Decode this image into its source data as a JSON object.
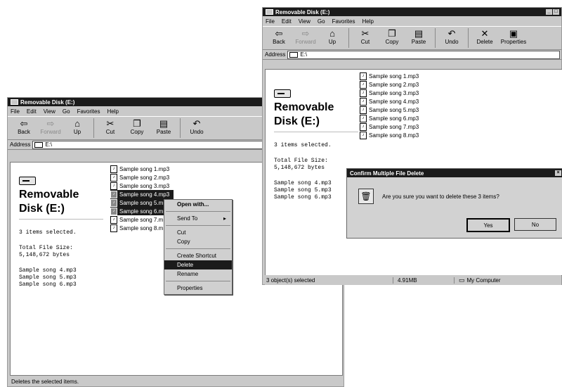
{
  "back_window": {
    "title": "Removable Disk (E:)",
    "menu": [
      "File",
      "Edit",
      "View",
      "Go",
      "Favorites",
      "Help"
    ],
    "toolbar": [
      {
        "icon": "back-icon",
        "label": "Back"
      },
      {
        "icon": "forward-icon",
        "label": "Forward"
      },
      {
        "icon": "up-icon",
        "label": "Up"
      },
      {
        "icon": "cut-icon",
        "label": "Cut"
      },
      {
        "icon": "copy-icon",
        "label": "Copy"
      },
      {
        "icon": "paste-icon",
        "label": "Paste"
      },
      {
        "icon": "undo-icon",
        "label": "Undo"
      }
    ],
    "address_label": "Address",
    "address_value": "E:\\",
    "panel": {
      "title_line1": "Removable",
      "title_line2": "Disk (E:)",
      "selected": "3 items selected.",
      "size_label": "Total File Size:",
      "size_value": "5,148,672 bytes",
      "selected_files": [
        "Sample song 4.mp3",
        "Sample song 5.mp3",
        "Sample song 6.mp3"
      ]
    },
    "files": [
      "Sample song 1.mp3",
      "Sample song 2.mp3",
      "Sample song 3.mp3",
      "Sample song 4.mp3",
      "Sample song 5.m",
      "Sample song 6.m",
      "Sample song 7.m",
      "Sample song 8.m"
    ],
    "status": "Deletes the selected items."
  },
  "context_menu": {
    "items": [
      "Open with...",
      "Send To",
      "Cut",
      "Copy",
      "Create Shortcut",
      "Delete",
      "Rename",
      "Properties"
    ]
  },
  "front_window": {
    "title": "Removable Disk (E:)",
    "menu": [
      "File",
      "Edit",
      "View",
      "Go",
      "Favorites",
      "Help"
    ],
    "toolbar": [
      {
        "icon": "back-icon",
        "label": "Back"
      },
      {
        "icon": "forward-icon",
        "label": "Forward"
      },
      {
        "icon": "up-icon",
        "label": "Up"
      },
      {
        "icon": "cut-icon",
        "label": "Cut"
      },
      {
        "icon": "copy-icon",
        "label": "Copy"
      },
      {
        "icon": "paste-icon",
        "label": "Paste"
      },
      {
        "icon": "undo-icon",
        "label": "Undo"
      },
      {
        "icon": "delete-icon",
        "label": "Delete"
      },
      {
        "icon": "properties-icon",
        "label": "Properties"
      }
    ],
    "address_label": "Address",
    "address_value": "E:\\",
    "panel": {
      "title_line1": "Removable",
      "title_line2": "Disk (E:)",
      "selected": "3 items selected.",
      "size_label": "Total File Size:",
      "size_value": "5,148,672 bytes",
      "selected_files": [
        "Sample song 4.mp3",
        "Sample song 5.mp3",
        "Sample song 6.mp3"
      ]
    },
    "files": [
      "Sample song 1.mp3",
      "Sample song 2.mp3",
      "Sample song 3.mp3",
      "Sample song 4.mp3",
      "Sample song 5.mp3",
      "Sample song 6.mp3",
      "Sample song 7.mp3",
      "Sample song 8.mp3"
    ],
    "status": {
      "objects": "3 object(s) selected",
      "size": "4.91MB",
      "zone": "My Computer"
    }
  },
  "dialog": {
    "title": "Confirm Multiple File Delete",
    "message": "Are you sure you want to delete these 3 items?",
    "yes": "Yes",
    "no": "No"
  }
}
